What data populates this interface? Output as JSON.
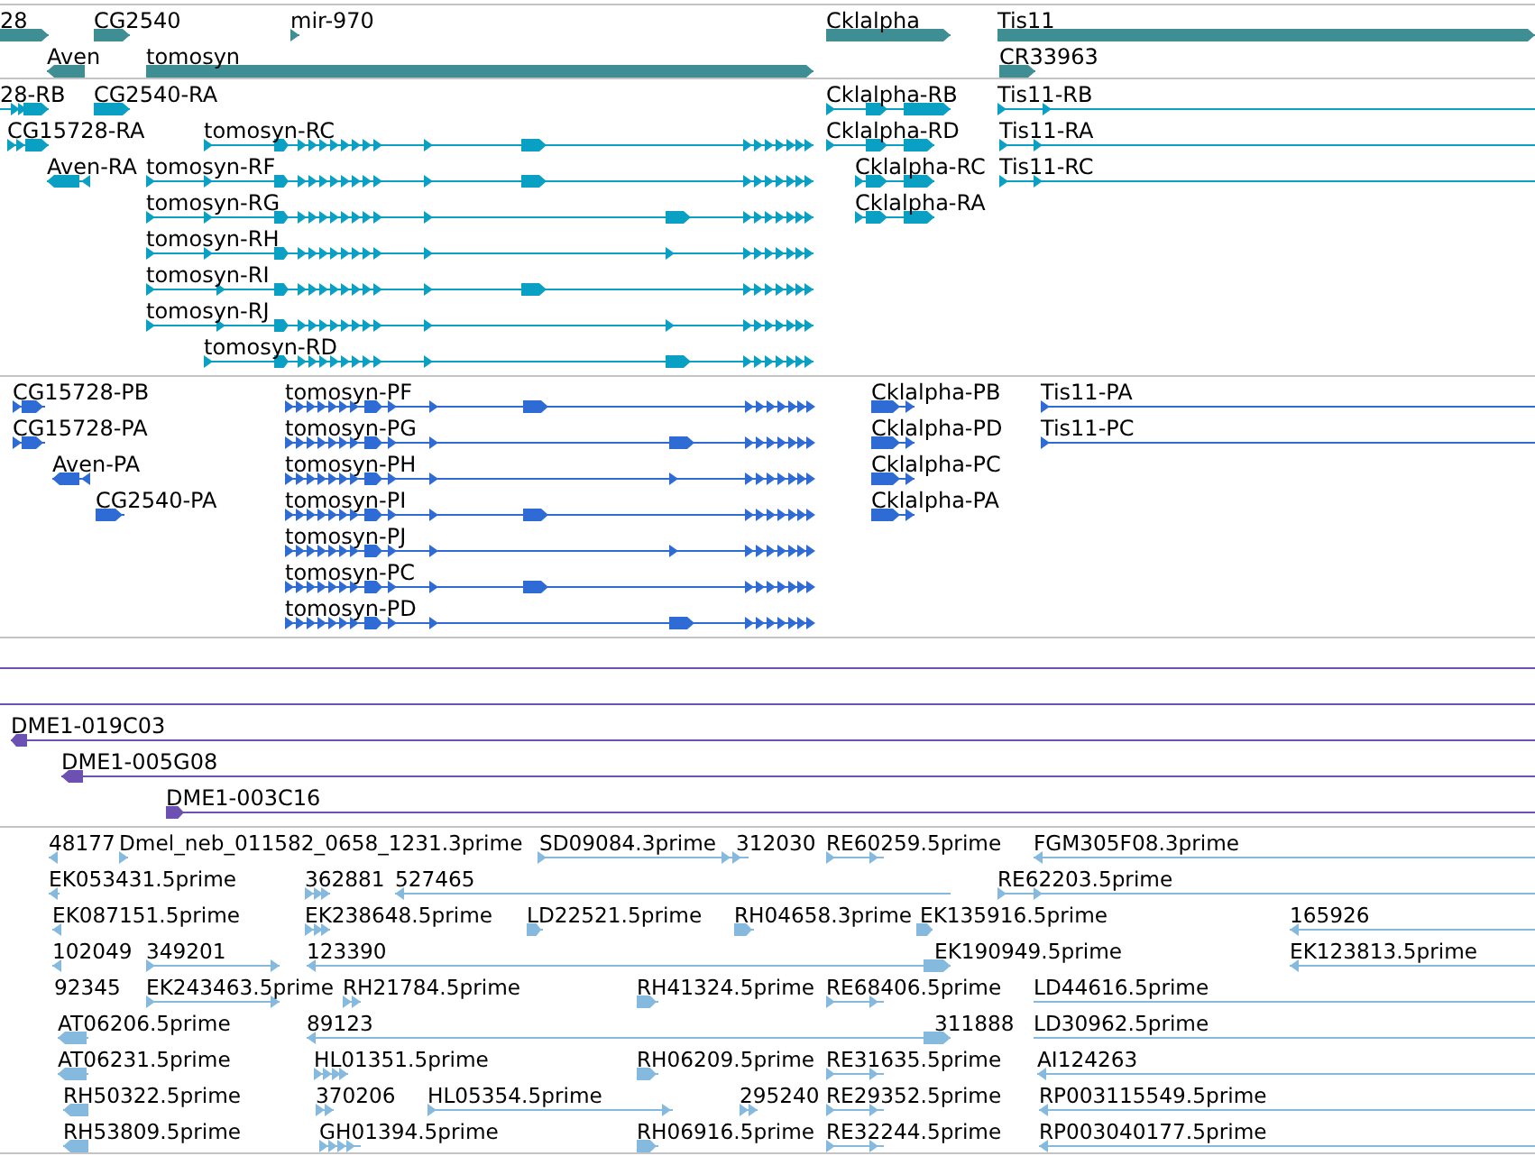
{
  "tracks": [
    {
      "kind": "gene",
      "color": "#3e8e93",
      "rows": [
        {
          "features": [
            {
              "label": "28",
              "reverse": false
            },
            {
              "label": "CG2540",
              "reverse": false
            },
            {
              "label": "mir-970",
              "reverse": false
            },
            {
              "label": "Cklalpha",
              "reverse": false
            },
            {
              "label": "Tis11",
              "reverse": false
            }
          ]
        },
        {
          "features": [
            {
              "label": "Aven",
              "reverse": true
            },
            {
              "label": "tomosyn",
              "reverse": false
            },
            {
              "label": "CR33963",
              "reverse": false
            }
          ]
        }
      ]
    },
    {
      "kind": "transcript",
      "color": "#0aa0c4",
      "rows": [
        {
          "features": [
            {
              "label": "28-RB",
              "reverse": false
            },
            {
              "label": "CG2540-RA",
              "reverse": false
            },
            {
              "label": "Cklalpha-RB",
              "reverse": false
            },
            {
              "label": "Tis11-RB",
              "reverse": false
            }
          ]
        },
        {
          "features": [
            {
              "label": "CG15728-RA",
              "reverse": false
            },
            {
              "label": "tomosyn-RC",
              "reverse": false
            },
            {
              "label": "Cklalpha-RD",
              "reverse": false
            },
            {
              "label": "Tis11-RA",
              "reverse": false
            }
          ]
        },
        {
          "features": [
            {
              "label": "Aven-RA",
              "reverse": true
            },
            {
              "label": "tomosyn-RF",
              "reverse": false
            },
            {
              "label": "Cklalpha-RC",
              "reverse": false
            },
            {
              "label": "Tis11-RC",
              "reverse": false
            }
          ]
        },
        {
          "features": [
            {
              "label": "tomosyn-RG",
              "reverse": false
            },
            {
              "label": "Cklalpha-RA",
              "reverse": false
            }
          ]
        },
        {
          "features": [
            {
              "label": "tomosyn-RH",
              "reverse": false
            }
          ]
        },
        {
          "features": [
            {
              "label": "tomosyn-RI",
              "reverse": false
            }
          ]
        },
        {
          "features": [
            {
              "label": "tomosyn-RJ",
              "reverse": false
            }
          ]
        },
        {
          "features": [
            {
              "label": "tomosyn-RD",
              "reverse": false
            }
          ]
        }
      ]
    },
    {
      "kind": "protein",
      "color": "#2f6bd5",
      "rows": [
        {
          "features": [
            {
              "label": "CG15728-PB",
              "reverse": false
            },
            {
              "label": "tomosyn-PF",
              "reverse": false
            },
            {
              "label": "Cklalpha-PB",
              "reverse": false
            },
            {
              "label": "Tis11-PA",
              "reverse": false
            }
          ]
        },
        {
          "features": [
            {
              "label": "CG15728-PA",
              "reverse": false
            },
            {
              "label": "tomosyn-PG",
              "reverse": false
            },
            {
              "label": "Cklalpha-PD",
              "reverse": false
            },
            {
              "label": "Tis11-PC",
              "reverse": false
            }
          ]
        },
        {
          "features": [
            {
              "label": "Aven-PA",
              "reverse": true
            },
            {
              "label": "tomosyn-PH",
              "reverse": false
            },
            {
              "label": "Cklalpha-PC",
              "reverse": false
            }
          ]
        },
        {
          "features": [
            {
              "label": "CG2540-PA",
              "reverse": false
            },
            {
              "label": "tomosyn-PI",
              "reverse": false
            },
            {
              "label": "Cklalpha-PA",
              "reverse": false
            }
          ]
        },
        {
          "features": [
            {
              "label": "tomosyn-PJ",
              "reverse": false
            }
          ]
        },
        {
          "features": [
            {
              "label": "tomosyn-PC",
              "reverse": false
            }
          ]
        },
        {
          "features": [
            {
              "label": "tomosyn-PD",
              "reverse": false
            }
          ]
        }
      ]
    },
    {
      "kind": "clone",
      "color": "#6c51b3",
      "rows": [
        {
          "features": [
            {
              "kind": "span"
            }
          ]
        },
        {
          "features": [
            {
              "kind": "span"
            }
          ]
        },
        {
          "features": [
            {
              "label": "DME1-019C03",
              "reverse": true
            }
          ]
        },
        {
          "features": [
            {
              "label": "DME1-005G08",
              "reverse": true
            }
          ]
        },
        {
          "features": [
            {
              "label": "DME1-003C16",
              "reverse": false
            }
          ]
        }
      ]
    },
    {
      "kind": "est",
      "color": "#86b9de",
      "rows": [
        {
          "features": [
            {
              "label": "48177",
              "reverse": true
            },
            {
              "label": "Dmel_neb_011582_0658_1231.3prime",
              "reverse": false
            },
            {
              "label": "SD09084.3prime",
              "reverse": false
            },
            {
              "label": "312030"
            },
            {
              "label": "RE60259.5prime",
              "reverse": false
            },
            {
              "label": "FGM305F08.3prime",
              "reverse": true
            }
          ]
        },
        {
          "features": [
            {
              "label": "EK053431.5prime",
              "reverse": true
            },
            {
              "label": "362881",
              "reverse": false
            },
            {
              "label": "527465",
              "reverse": true
            },
            {
              "label": "RE62203.5prime",
              "reverse": false
            }
          ]
        },
        {
          "features": [
            {
              "label": "EK087151.5prime",
              "reverse": true
            },
            {
              "label": "EK238648.5prime",
              "reverse": false
            },
            {
              "label": "LD22521.5prime",
              "reverse": false
            },
            {
              "label": "RH04658.3prime",
              "reverse": false
            },
            {
              "label": "EK135916.5prime",
              "reverse": false
            },
            {
              "label": "165926",
              "reverse": true
            }
          ]
        },
        {
          "features": [
            {
              "label": "102049",
              "reverse": true
            },
            {
              "label": "349201",
              "reverse": false
            },
            {
              "label": "123390",
              "reverse": true
            },
            {
              "label": "EK190949.5prime",
              "reverse": false
            },
            {
              "label": "EK123813.5prime",
              "reverse": true
            }
          ]
        },
        {
          "features": [
            {
              "label": "92345"
            },
            {
              "label": "EK243463.5prime",
              "reverse": false
            },
            {
              "label": "RH21784.5prime",
              "reverse": false
            },
            {
              "label": "RH41324.5prime",
              "reverse": false
            },
            {
              "label": "RE68406.5prime",
              "reverse": false
            },
            {
              "label": "LD44616.5prime"
            }
          ]
        },
        {
          "features": [
            {
              "label": "AT06206.5prime",
              "reverse": true
            },
            {
              "label": "89123",
              "reverse": true
            },
            {
              "label": "311888",
              "reverse": false
            },
            {
              "label": "LD30962.5prime"
            }
          ]
        },
        {
          "features": [
            {
              "label": "AT06231.5prime",
              "reverse": true
            },
            {
              "label": "HL01351.5prime",
              "reverse": false
            },
            {
              "label": "RH06209.5prime",
              "reverse": false
            },
            {
              "label": "RE31635.5prime",
              "reverse": false
            },
            {
              "label": "AI124263",
              "reverse": true
            }
          ]
        },
        {
          "features": [
            {
              "label": "RH50322.5prime",
              "reverse": true
            },
            {
              "label": "370206",
              "reverse": false
            },
            {
              "label": "HL05354.5prime",
              "reverse": false
            },
            {
              "label": "295240",
              "reverse": false
            },
            {
              "label": "RE29352.5prime",
              "reverse": false
            },
            {
              "label": "RP003115549.5prime",
              "reverse": true
            }
          ]
        },
        {
          "features": [
            {
              "label": "RH53809.5prime",
              "reverse": true
            },
            {
              "label": "GH01394.5prime",
              "reverse": false
            },
            {
              "label": "RH06916.5prime",
              "reverse": false
            },
            {
              "label": "RE32244.5prime",
              "reverse": false
            },
            {
              "label": "RP003040177.5prime",
              "reverse": true
            }
          ]
        }
      ]
    }
  ]
}
